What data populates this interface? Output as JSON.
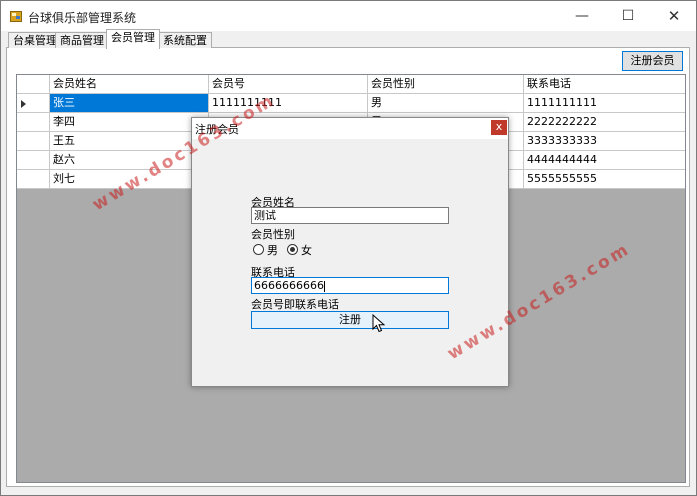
{
  "window": {
    "title": "台球俱乐部管理系统",
    "minimize": "—",
    "maximize": "☐",
    "close": "✕"
  },
  "tabs": [
    {
      "label": "台桌管理",
      "active": false
    },
    {
      "label": "商品管理",
      "active": false
    },
    {
      "label": "会员管理",
      "active": true
    },
    {
      "label": "系统配置",
      "active": false
    }
  ],
  "register_button": "注册会员",
  "grid": {
    "columns": [
      "会员姓名",
      "会员号",
      "会员性别",
      "联系电话"
    ],
    "rows": [
      {
        "name": "张三",
        "number": "1111111111",
        "gender": "男",
        "phone": "1111111111",
        "selected": true
      },
      {
        "name": "李四",
        "number": "",
        "gender": "男",
        "phone": "2222222222",
        "selected": false
      },
      {
        "name": "王五",
        "number": "",
        "gender": "",
        "phone": "3333333333",
        "selected": false
      },
      {
        "name": "赵六",
        "number": "",
        "gender": "",
        "phone": "4444444444",
        "selected": false
      },
      {
        "name": "刘七",
        "number": "",
        "gender": "",
        "phone": "5555555555",
        "selected": false
      }
    ]
  },
  "dialog": {
    "title": "注册会员",
    "close": "x",
    "name_label": "会员姓名",
    "name_value": "测试",
    "gender_label": "会员性别",
    "gender_options": [
      "男",
      "女"
    ],
    "gender_selected": "女",
    "phone_label": "联系电话",
    "phone_value": "6666666666",
    "note": "会员号即联系电话",
    "submit": "注册"
  },
  "watermark": "www.doc163.com",
  "colors": {
    "selection": "#0078d7",
    "grid_background": "#ababab",
    "close_button": "#c0392b",
    "watermark": "#c81e1e"
  }
}
